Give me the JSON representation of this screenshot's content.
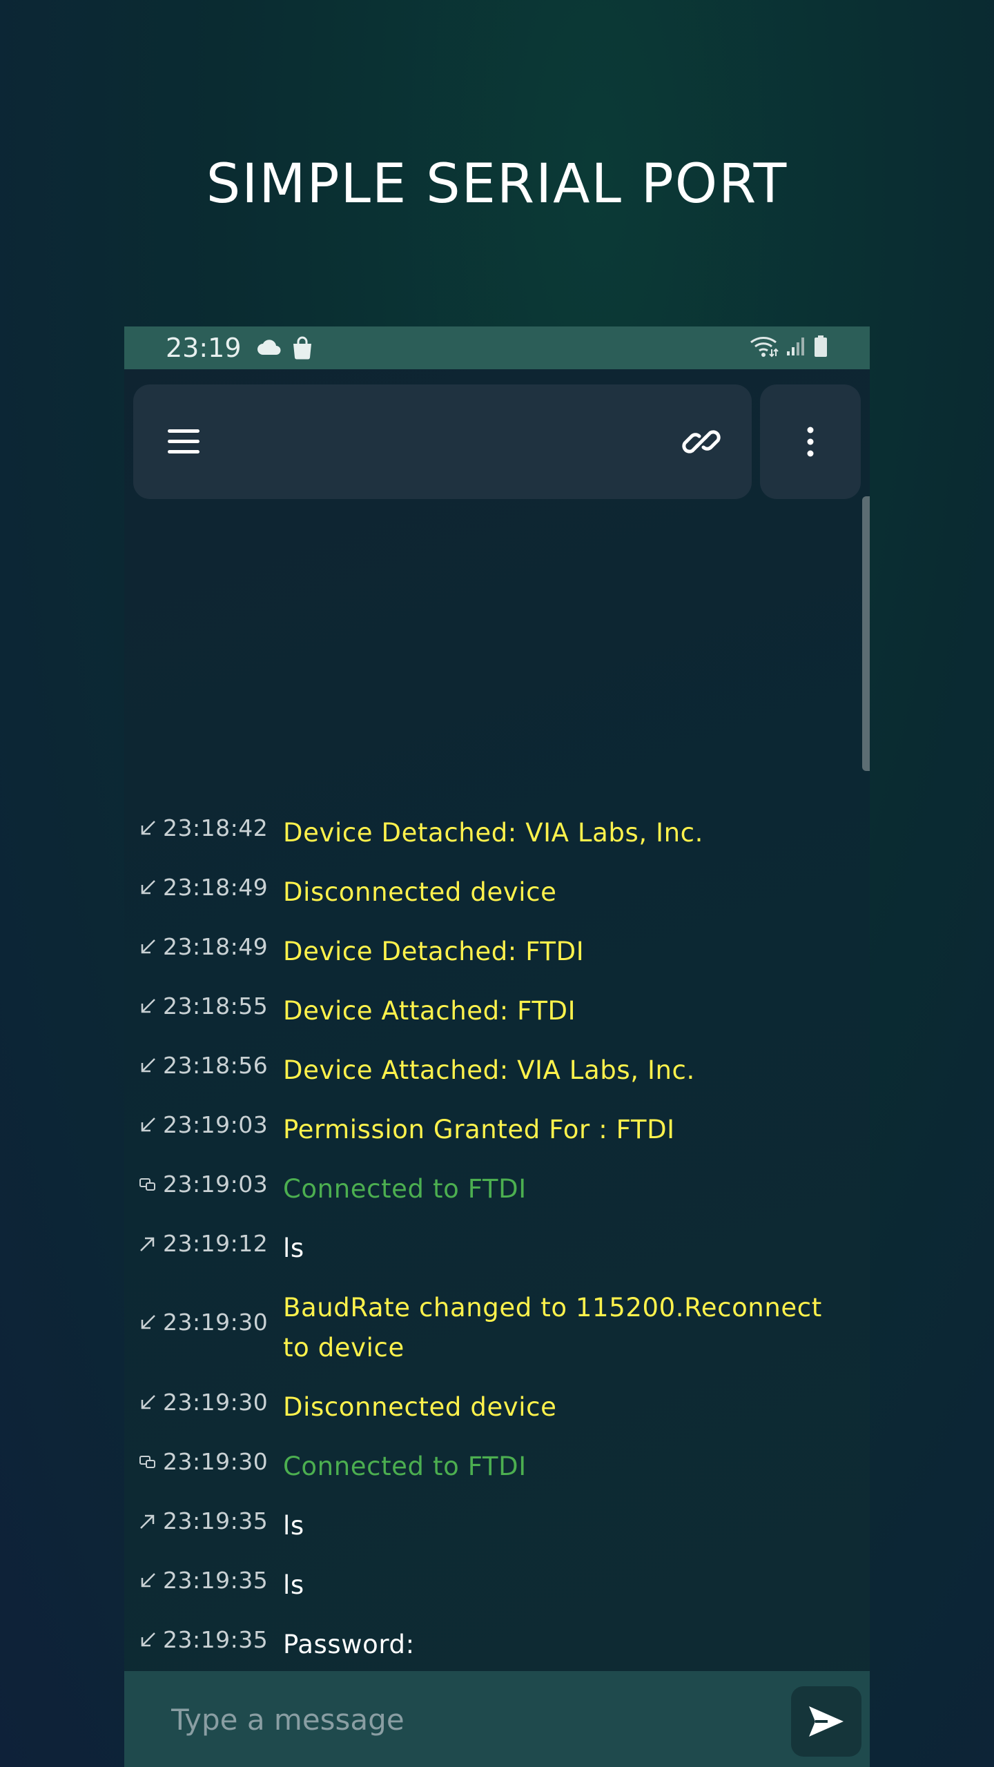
{
  "promo": {
    "title": "SIMPLE SERIAL PORT"
  },
  "status_bar": {
    "time": "23:19",
    "icons": [
      "cloud-icon",
      "shopping-bag-icon",
      "wifi-icon",
      "signal-icon",
      "battery-icon"
    ]
  },
  "toolbar": {
    "menu_icon": "hamburger-menu-icon",
    "link_icon": "link-icon",
    "more_icon": "more-vertical-icon"
  },
  "log": [
    {
      "dir": "in",
      "time": "23:18:42",
      "text": "Device Detached: VIA Labs, Inc.",
      "color": "yellow"
    },
    {
      "dir": "in",
      "time": "23:18:49",
      "text": "Disconnected device",
      "color": "yellow"
    },
    {
      "dir": "in",
      "time": "23:18:49",
      "text": "Device Detached: FTDI",
      "color": "yellow"
    },
    {
      "dir": "in",
      "time": "23:18:55",
      "text": "Device Attached: FTDI",
      "color": "yellow"
    },
    {
      "dir": "in",
      "time": "23:18:56",
      "text": "Device Attached: VIA Labs, Inc.",
      "color": "yellow"
    },
    {
      "dir": "in",
      "time": "23:19:03",
      "text": "Permission Granted For : FTDI",
      "color": "yellow"
    },
    {
      "dir": "status",
      "time": "23:19:03",
      "text": "Connected to FTDI",
      "color": "green"
    },
    {
      "dir": "out",
      "time": "23:19:12",
      "text": "ls",
      "color": "white"
    },
    {
      "dir": "in",
      "time": "23:19:30",
      "text": "BaudRate changed to 115200.Reconnect to device",
      "color": "yellow"
    },
    {
      "dir": "in",
      "time": "23:19:30",
      "text": "Disconnected device",
      "color": "yellow"
    },
    {
      "dir": "status",
      "time": "23:19:30",
      "text": "Connected to FTDI",
      "color": "green"
    },
    {
      "dir": "out",
      "time": "23:19:35",
      "text": "ls",
      "color": "white"
    },
    {
      "dir": "in",
      "time": "23:19:35",
      "text": "ls",
      "color": "white"
    },
    {
      "dir": "in",
      "time": "23:19:35",
      "text": "Password:",
      "color": "white"
    }
  ],
  "composer": {
    "placeholder": "Type a message",
    "send_icon": "send-icon"
  },
  "colors": {
    "yellow": "#fff24c",
    "green": "#4caf50",
    "white": "#ffffff"
  }
}
